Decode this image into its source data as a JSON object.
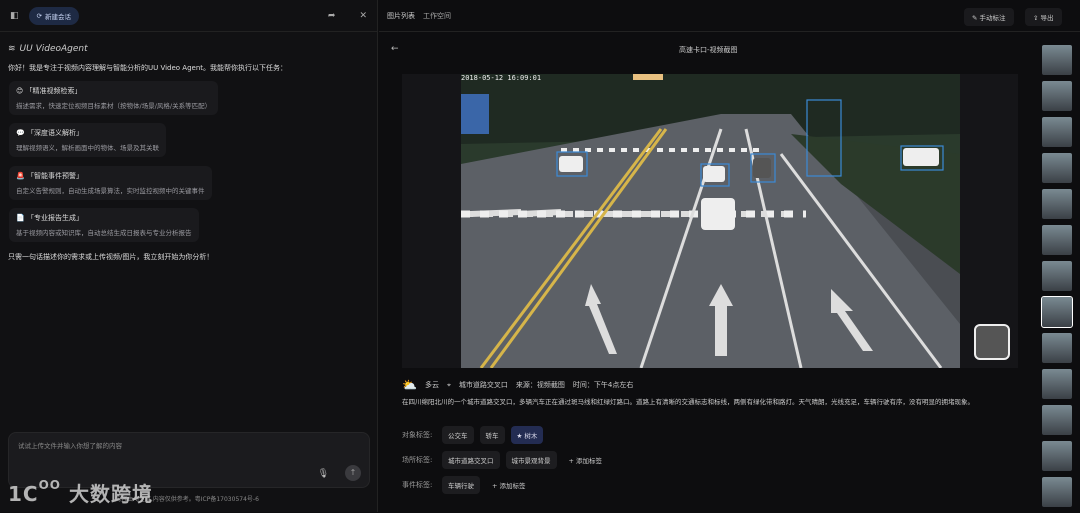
{
  "left": {
    "new_chat": "新建会话",
    "brand": "UU VideoAgent",
    "intro": "你好！我是专注于视频内容理解与智能分析的UU Video Agent。我能帮你执行以下任务：",
    "cards": [
      {
        "icon": "😊",
        "title": "「精准视频检索」",
        "desc": "描述需求，快速定位视频目标素材（按物体/场景/风格/关系等匹配）"
      },
      {
        "icon": "💬",
        "title": "「深度语义解析」",
        "desc": "理解视频语义，解析画面中的物体、场景及其关联"
      },
      {
        "icon": "🚨",
        "title": "「智能事件预警」",
        "desc": "自定义告警规则，自动生成场景算法，实时监控视频中的关键事件"
      },
      {
        "icon": "📄",
        "title": "「专业报告生成」",
        "desc": "基于视频内容或知识库，自动总结生成日报表与专业分析报告"
      }
    ],
    "outro": "只需一句话描述你的需求或上传视频/图片，我立刻开始为你分析！",
    "input_placeholder": "试试上传文件并输入你想了解的内容",
    "footer": "内容由AI生成,内容仅供参考。粤ICP备17030574号-6",
    "watermark": "大数跨境"
  },
  "right": {
    "tabs": [
      "图片列表",
      "工作空间"
    ],
    "manual_label": "手动标注",
    "export": "导出",
    "title": "高速卡口-视频截图",
    "timestamp": "2018-05-12 16:09:01",
    "weather": "多云",
    "location": "城市道路交叉口",
    "source": "来源：视频截图",
    "time": "时间：下午4点左右",
    "description": "在四川绵阳北川的一个城市道路交叉口，多辆汽车正在通过斑马线和红绿灯路口。道路上有清晰的交通标志和标线，两侧有绿化带和路灯。天气晴朗，光线充足，车辆行驶有序，没有明显的拥堵现象。",
    "object_label": "对象标签:",
    "object_tags": [
      "公交车",
      "轿车",
      "树木"
    ],
    "scene_label": "场所标签:",
    "scene_tags": [
      "城市道路交叉口",
      "城市景观背景"
    ],
    "event_label": "事件标签:",
    "event_tags": [
      "车辆行驶"
    ],
    "add_tag": "+ 添加标签"
  }
}
